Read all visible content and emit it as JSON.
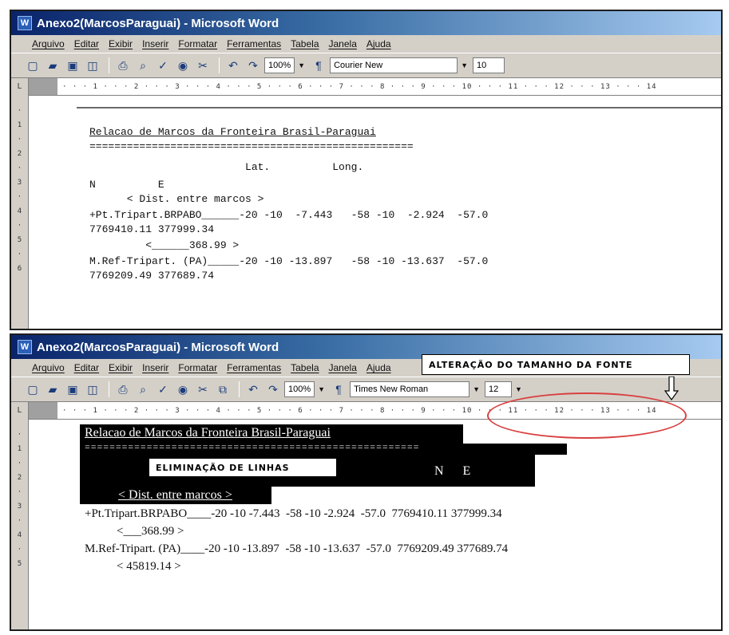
{
  "windows": [
    {
      "title": "Anexo2(MarcosParaguai) - Microsoft Word",
      "menu": [
        "Arquivo",
        "Editar",
        "Exibir",
        "Inserir",
        "Formatar",
        "Ferramentas",
        "Tabela",
        "Janela",
        "Ajuda"
      ],
      "zoom": "100%",
      "font": "Courier New",
      "font_size": "10",
      "ruler": "· · · 1 · · · 2 · · · 3 · · · 4 · · · 5 · · · 6 · · · 7 · · · 8 · · · 9 · · · 10 · · · 11 · · · 12 · · · 13 · · · 14",
      "vruler": [
        "·",
        "1",
        "·",
        "2",
        "·",
        "3",
        "·",
        "4",
        "·",
        "5",
        "·",
        "6"
      ],
      "lines": [
        "Relacao de Marcos da Fronteira Brasil-Paraguai",
        "====================================================",
        "                         Lat.          Long.",
        "N          E",
        "      < Dist. entre marcos >",
        "+Pt.Tripart.BRPABO______-20 -10  -7.443   -58 -10  -2.924  -57.0",
        "7769410.11 377999.34",
        "         <______368.99 >",
        "M.Ref-Tripart. (PA)_____-20 -10 -13.897   -58 -10 -13.637  -57.0",
        "7769209.49 377689.74"
      ]
    },
    {
      "title": "Anexo2(MarcosParaguai) - Microsoft Word",
      "menu": [
        "Arquivo",
        "Editar",
        "Exibir",
        "Inserir",
        "Formatar",
        "Ferramentas",
        "Tabela",
        "Janela",
        "Ajuda"
      ],
      "zoom": "100%",
      "font": "Times New Roman",
      "font_size": "12",
      "ruler": "· · · 1 · · · 2 · · · 3 · · · 4 · · · 5 · · · 6 · · · 7 · · · 8 · · · 9 · · · 10 · · · 11 · · · 12 · · · 13 · · · 14",
      "vruler": [
        "·",
        "1",
        "·",
        "2",
        "·",
        "3",
        "·",
        "4",
        "·",
        "5"
      ],
      "callout_font": "ALTERAÇÃO DO TAMANHO DA FONTE",
      "callout_lines": "ELIMINAÇÃO DE LINHAS",
      "lines": [
        "Relacao de Marcos da Fronteira Brasil-Paraguai",
        "======================================================",
        "N      E",
        "< Dist. entre marcos >",
        "+Pt.Tripart.BRPABO____-20 -10 -7.443  -58 -10 -2.924  -57.0  7769410.11 377999.34",
        "<___368.99 >",
        "M.Ref-Tripart. (PA)____-20 -10 -13.897  -58 -10 -13.637  -57.0  7769209.49 377689.74",
        "< 45819.14 >"
      ]
    }
  ]
}
